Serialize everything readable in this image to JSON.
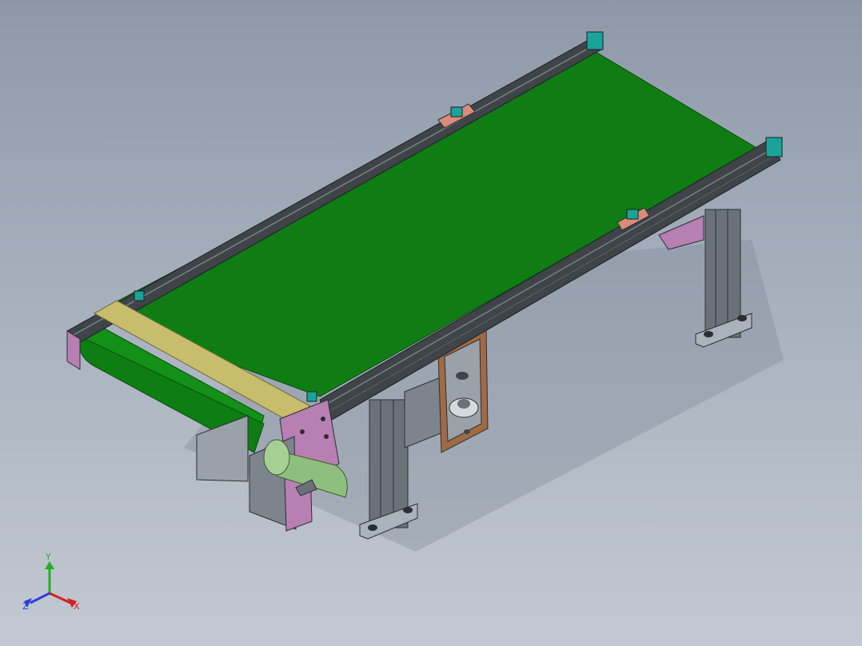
{
  "viewport": {
    "background_top": "#8e99a8",
    "background_bottom": "#c3c9d2"
  },
  "model": {
    "belt_color": "#0f7d14",
    "frame_color": "#3f4448",
    "guard_plate_color": "#c7bd6c",
    "end_plate_color": "#b77fb2",
    "bracket_color": "#d98c7a",
    "motor_color": "#8fbf7e",
    "leg_color": "#6a7178",
    "connector_color": "#1aa39a"
  },
  "triad": {
    "x_label": "X",
    "y_label": "Y",
    "z_label": "Z",
    "x_color": "#d42020",
    "y_color": "#23b023",
    "z_color": "#2a3fd8"
  }
}
